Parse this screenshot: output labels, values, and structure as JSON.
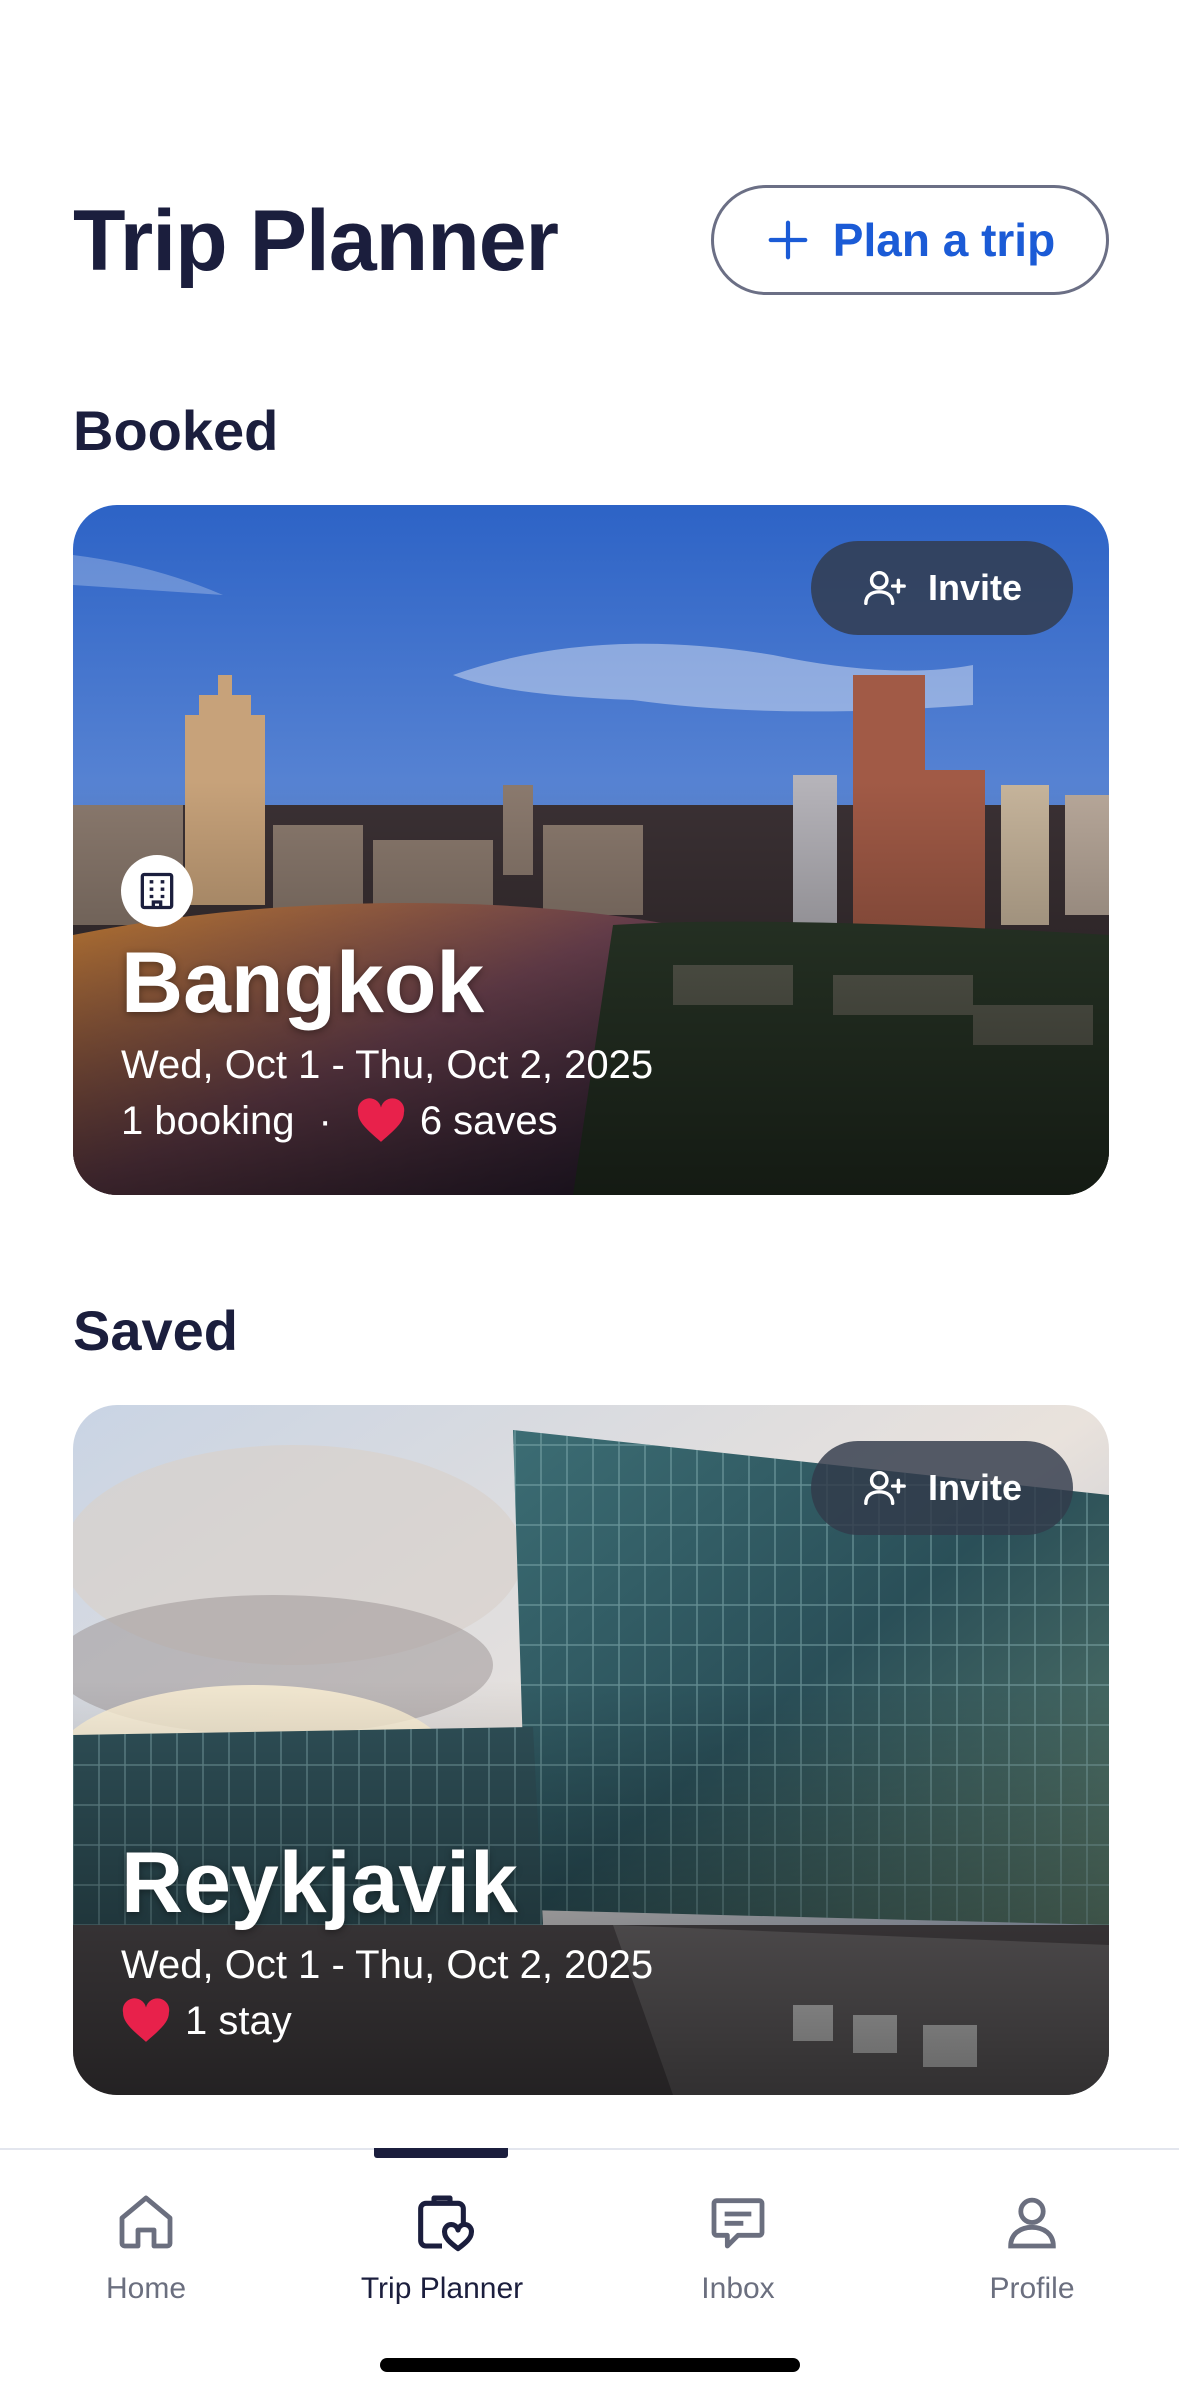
{
  "header": {
    "title": "Trip Planner",
    "plan_button_label": "Plan a trip",
    "plan_button_icon": "plus-icon"
  },
  "accent_color": "#1b5bd6",
  "heart_color": "#e8214b",
  "sections": {
    "booked_title": "Booked",
    "saved_title": "Saved"
  },
  "booked_trip": {
    "city": "Bangkok",
    "dates": "Wed, Oct 1 - Thu, Oct 2, 2025",
    "bookings": "1 booking",
    "separator": "·",
    "saves": "6 saves",
    "invite_label": "Invite",
    "badge_icon": "building-icon"
  },
  "saved_trip": {
    "city": "Reykjavik",
    "dates": "Wed, Oct 1 - Thu, Oct 2, 2025",
    "saves": "1 stay",
    "invite_label": "Invite"
  },
  "tabbar": {
    "tabs": [
      {
        "label": "Home",
        "icon": "home-icon"
      },
      {
        "label": "Trip Planner",
        "icon": "suitcase-heart-icon",
        "active": true
      },
      {
        "label": "Inbox",
        "icon": "chat-icon"
      },
      {
        "label": "Profile",
        "icon": "person-icon"
      }
    ]
  }
}
